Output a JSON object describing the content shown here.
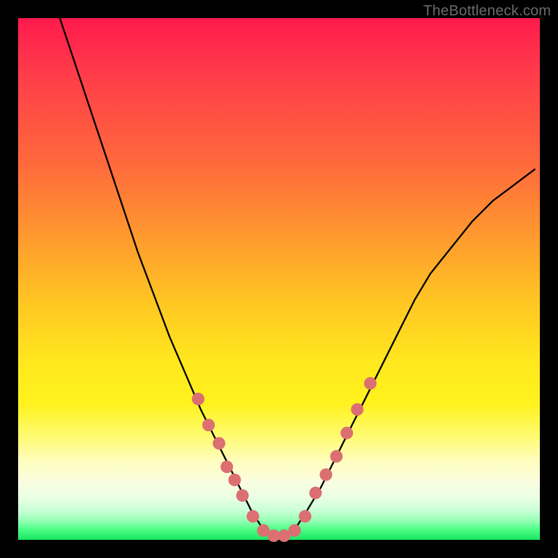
{
  "watermark": "TheBottleneck.com",
  "chart_data": {
    "type": "line",
    "title": "",
    "xlabel": "",
    "ylabel": "",
    "xlim": [
      0,
      100
    ],
    "ylim": [
      0,
      100
    ],
    "grid": false,
    "legend": false,
    "annotations": [],
    "background_gradient": {
      "direction": "vertical",
      "stops": [
        {
          "pos": 0.0,
          "color": "#ff1a4d"
        },
        {
          "pos": 0.28,
          "color": "#ff6a3c"
        },
        {
          "pos": 0.55,
          "color": "#ffc822"
        },
        {
          "pos": 0.74,
          "color": "#fff21e"
        },
        {
          "pos": 0.89,
          "color": "#f9fde0"
        },
        {
          "pos": 1.0,
          "color": "#18e55e"
        }
      ]
    },
    "series": [
      {
        "name": "curve",
        "type": "line",
        "color": "#000000",
        "x": [
          8,
          11,
          14,
          17,
          20,
          23,
          26,
          29,
          32,
          35,
          38,
          41,
          43,
          45,
          47,
          49,
          51,
          53,
          55,
          58,
          61,
          64,
          67,
          70,
          73,
          76,
          79,
          83,
          87,
          91,
          95,
          99
        ],
        "y": [
          100,
          91,
          82,
          73,
          64,
          55,
          47,
          39,
          32,
          25,
          19,
          13,
          9,
          5,
          2,
          0.5,
          0.5,
          2,
          5,
          10,
          16,
          22,
          28,
          34,
          40,
          46,
          51,
          56,
          61,
          65,
          68,
          71
        ]
      },
      {
        "name": "dots",
        "type": "scatter",
        "color": "#db6f72",
        "radius": 9,
        "x": [
          34.5,
          36.5,
          38.5,
          40.0,
          41.5,
          43.0,
          45.0,
          47.0,
          49.0,
          51.0,
          53.0,
          55.0,
          57.0,
          59.0,
          61.0,
          63.0,
          65.0,
          67.5
        ],
        "y": [
          27.0,
          22.0,
          18.5,
          14.0,
          11.5,
          8.5,
          4.5,
          1.8,
          0.8,
          0.8,
          1.8,
          4.5,
          9.0,
          12.5,
          16.0,
          20.5,
          25.0,
          30.0
        ]
      }
    ]
  }
}
